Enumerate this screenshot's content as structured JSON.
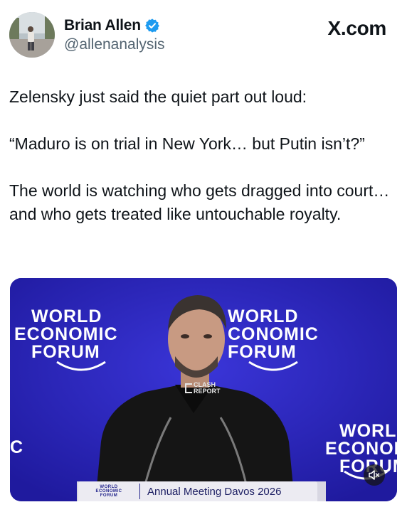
{
  "author": {
    "display_name": "Brian Allen",
    "handle": "@allenanalysis",
    "verified_icon": "verified-badge-icon",
    "verified_color": "#1d9bf0"
  },
  "site": {
    "label": "X.com"
  },
  "tweet": {
    "paragraph_1": "Zelensky just said the quiet part out loud:",
    "paragraph_2": "“Maduro is on trial in New York… but Putin isn’t?”",
    "paragraph_3": "The world is watching who gets dragged into court… and who gets treated like untouchable royalty."
  },
  "media": {
    "backdrop_color": "#241fb0",
    "backdrop_logos": [
      {
        "lines": [
          "WORLD",
          "ECONOMIC",
          "FORUM"
        ]
      },
      {
        "lines": [
          "WORLD",
          "CONOMIC",
          "FORUM"
        ]
      },
      {
        "lines": [
          "C"
        ]
      },
      {
        "lines": [
          "WORLD",
          "ECONOM",
          "FORUM"
        ]
      }
    ],
    "watermark": {
      "line_1": "CLASH",
      "line_2": "REPORT"
    },
    "lower_third": {
      "logo_lines": [
        "WORLD",
        "ECONOMIC",
        "FORUM"
      ],
      "caption": "Annual Meeting Davos 2026"
    },
    "mute_icon": "speaker-muted-icon"
  }
}
